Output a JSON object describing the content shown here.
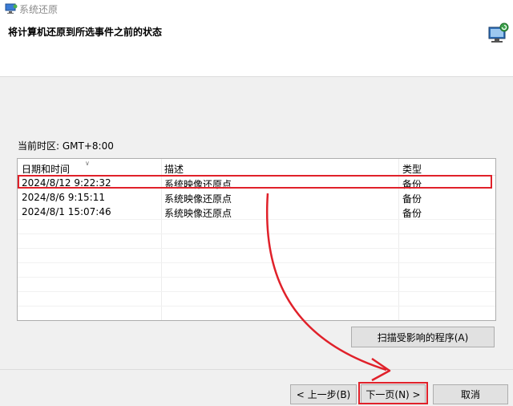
{
  "window": {
    "title": "系统还原",
    "heading": "将计算机还原到所选事件之前的状态",
    "icon": "system-restore-icon",
    "wizard_icon": "monitor-restore-icon"
  },
  "timezone_label": "当前时区: GMT+8:00",
  "table": {
    "columns": [
      "日期和时间",
      "描述",
      "类型"
    ],
    "rows": [
      {
        "date": "2024/8/12 9:22:32",
        "desc": "系统映像还原点",
        "type": "备份"
      },
      {
        "date": "2024/8/6 9:15:11",
        "desc": "系统映像还原点",
        "type": "备份"
      },
      {
        "date": "2024/8/1 15:07:46",
        "desc": "系统映像还原点",
        "type": "备份"
      }
    ]
  },
  "buttons": {
    "scan": "扫描受影响的程序(A)",
    "back": "< 上一步(B)",
    "next": "下一页(N) >",
    "cancel": "取消"
  },
  "colors": {
    "annotation": "#e0212a",
    "header_bg": "#ffffff",
    "window_bg": "#f0f0f0"
  }
}
